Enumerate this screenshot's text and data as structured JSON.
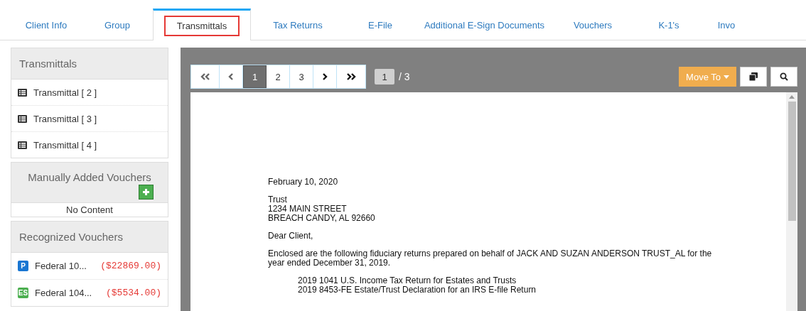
{
  "tabs": [
    {
      "label": "Client Info",
      "selected": false
    },
    {
      "label": "Group",
      "selected": false
    },
    {
      "label": "Transmittals",
      "selected": true
    },
    {
      "label": "Tax Returns",
      "selected": false
    },
    {
      "label": "E-File",
      "selected": false
    },
    {
      "label": "Additional E-Sign Documents",
      "selected": false
    },
    {
      "label": "Vouchers",
      "selected": false
    },
    {
      "label": "K-1's",
      "selected": false
    },
    {
      "label": "Invo",
      "selected": false
    }
  ],
  "sidebar": {
    "transmittals": {
      "title": "Transmittals",
      "items": [
        {
          "label": "Transmittal [ 2 ]"
        },
        {
          "label": "Transmittal [ 3 ]"
        },
        {
          "label": "Transmittal [ 4 ]"
        }
      ]
    },
    "manual_vouchers": {
      "title": "Manually Added Vouchers",
      "empty_text": "No Content"
    },
    "recognized_vouchers": {
      "title": "Recognized Vouchers",
      "items": [
        {
          "kind": "payment",
          "badge": "P",
          "label": "Federal 10...",
          "amount": "($22869.00)"
        },
        {
          "kind": "estimated",
          "badge": "ES",
          "label": "Federal 104...",
          "amount": "($5534.00)"
        }
      ]
    }
  },
  "viewer": {
    "pages": [
      {
        "label": "1",
        "selected": true
      },
      {
        "label": "2",
        "selected": false
      },
      {
        "label": "3",
        "selected": false
      }
    ],
    "page_input": "1",
    "page_total": "/ 3",
    "move_to": "Move To",
    "document": [
      {
        "kind": "line",
        "text": "February 10, 2020"
      },
      {
        "kind": "gap"
      },
      {
        "kind": "line",
        "text": "Trust"
      },
      {
        "kind": "line",
        "text": "1234 MAIN STREET"
      },
      {
        "kind": "line",
        "text": "BREACH CANDY, AL 92660"
      },
      {
        "kind": "gap"
      },
      {
        "kind": "line",
        "text": "Dear Client,"
      },
      {
        "kind": "gap"
      },
      {
        "kind": "para",
        "text": "Enclosed are the following fiduciary returns prepared on behalf of JACK AND SUZAN ANDERSON TRUST_AL for the year ended December 31, 2019."
      },
      {
        "kind": "gap"
      },
      {
        "kind": "indent",
        "text": "2019 1041 U.S. Income Tax Return for Estates and Trusts"
      },
      {
        "kind": "indent",
        "text": "2019 8453-FE Estate/Trust Declaration for an IRS E-file Return"
      }
    ]
  }
}
